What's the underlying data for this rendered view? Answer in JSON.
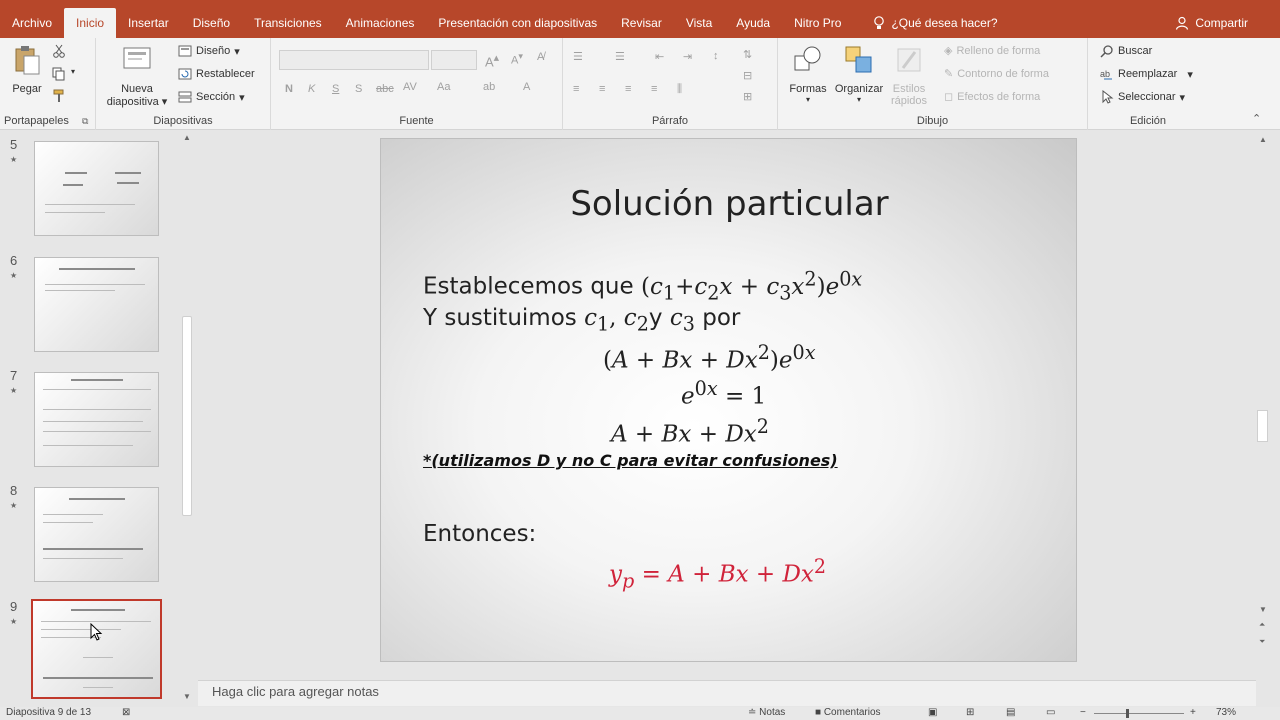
{
  "tabs": [
    "Archivo",
    "Inicio",
    "Insertar",
    "Diseño",
    "Transiciones",
    "Animaciones",
    "Presentación con diapositivas",
    "Revisar",
    "Vista",
    "Ayuda",
    "Nitro Pro"
  ],
  "active_tab": "Inicio",
  "tell_me": "¿Qué desea hacer?",
  "share": "Compartir",
  "ribbon": {
    "clipboard": {
      "paste": "Pegar",
      "label": "Portapapeles"
    },
    "slides": {
      "new_line1": "Nueva",
      "new_line2": "diapositiva",
      "layout": "Diseño",
      "reset": "Restablecer",
      "section": "Sección",
      "label": "Diapositivas"
    },
    "font": {
      "label": "Fuente",
      "bold": "N",
      "italic": "K",
      "underline": "S",
      "shadow": "S",
      "strike": "abc"
    },
    "paragraph": {
      "label": "Párrafo"
    },
    "drawing": {
      "shapes": "Formas",
      "arrange": "Organizar",
      "quick_styles_1": "Estilos",
      "quick_styles_2": "rápidos",
      "fill": "Relleno de forma",
      "outline": "Contorno de forma",
      "effects": "Efectos de forma",
      "label": "Dibujo"
    },
    "editing": {
      "find": "Buscar",
      "replace": "Reemplazar",
      "select": "Seleccionar",
      "label": "Edición"
    }
  },
  "thumbnails": [
    {
      "num": "5"
    },
    {
      "num": "6"
    },
    {
      "num": "7"
    },
    {
      "num": "8"
    },
    {
      "num": "9"
    }
  ],
  "slide": {
    "title": "Solución particular",
    "line1_text": "Establecemos que ",
    "line2_text": "Y sustituimos ",
    "line2_text_mid": "y ",
    "line2_text_end": " por",
    "note": "*(utilizamos D y no C para evitar confusiones)",
    "then": "Entonces:"
  },
  "notes_placeholder": "Haga clic para agregar notas",
  "status": {
    "slide_count": "Diapositiva 9 de 13",
    "notes": "Notas",
    "comments": "Comentarios",
    "zoom": "73%"
  }
}
